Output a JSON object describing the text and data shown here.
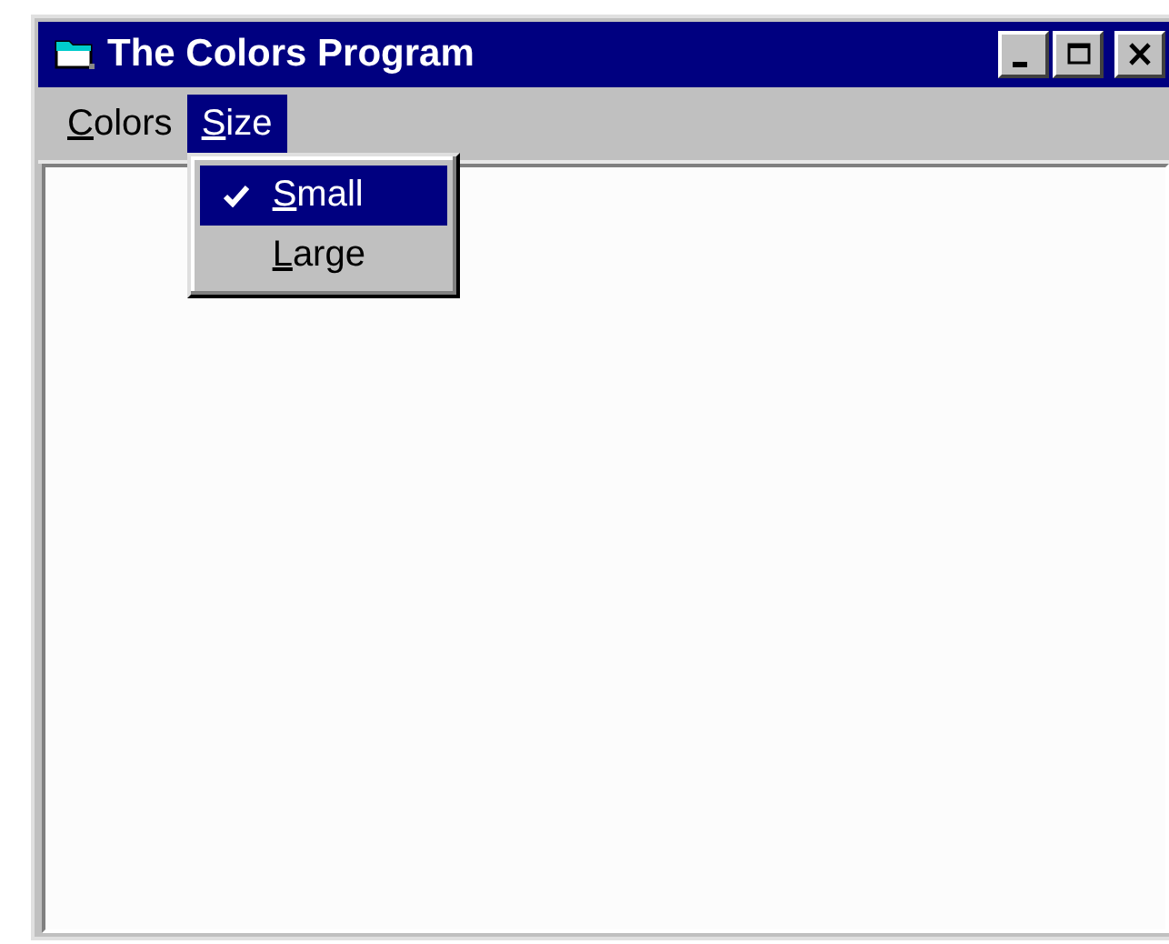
{
  "window": {
    "title": "The Colors Program"
  },
  "title_buttons": [
    {
      "kind": "minimize"
    },
    {
      "kind": "maximize"
    },
    {
      "kind": "close"
    }
  ],
  "menu_bar": [
    {
      "mnemonic": "C",
      "rest": "olors",
      "selected": false
    },
    {
      "mnemonic": "S",
      "rest": "ize",
      "selected": true,
      "expanded": true,
      "items": [
        {
          "mnemonic": "S",
          "rest": "mall",
          "checked": true,
          "selected": true
        },
        {
          "mnemonic": "L",
          "rest": "arge",
          "checked": false,
          "selected": false
        }
      ]
    }
  ]
}
